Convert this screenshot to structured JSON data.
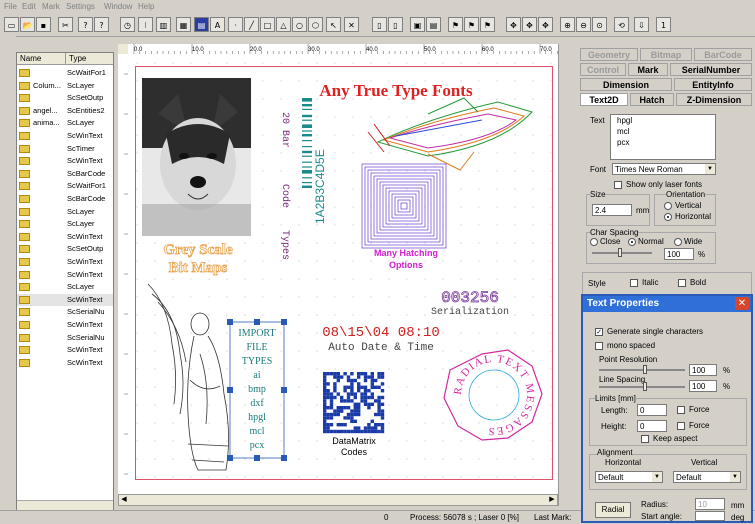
{
  "menu": [
    "File",
    "Edit",
    "Mark",
    "Settings",
    "Window",
    "Help"
  ],
  "toolbar": {
    "groups": [
      "new",
      "open",
      "save",
      "cut",
      "help",
      "whats-this",
      "clock",
      "marker",
      "barcode",
      "hatch",
      "text",
      "point",
      "line",
      "rect",
      "triangle",
      "circle",
      "polygon",
      "pointer",
      "cross",
      "doc-a",
      "doc-b",
      "doc-c",
      "doc-d",
      "doc-e",
      "doc-f",
      "doc-g",
      "move-a",
      "move-b",
      "move-c",
      "zoom-in",
      "zoom-out",
      "zoom-fit",
      "rotate-a",
      "rotate-b"
    ],
    "digit": "1"
  },
  "ruler_h": [
    "0.0",
    "10.0",
    "20.0",
    "30.0",
    "40.0",
    "50.0",
    "60.0",
    "70.0"
  ],
  "object_list": {
    "headers": {
      "name": "Name",
      "type": "Type"
    },
    "rows": [
      {
        "name": "",
        "type": "ScWaitFor1"
      },
      {
        "name": "Colum...",
        "type": "ScLayer"
      },
      {
        "name": "",
        "type": "ScSetOutp"
      },
      {
        "name": "angel...",
        "type": "ScEntities2"
      },
      {
        "name": "anima...",
        "type": "ScLayer"
      },
      {
        "name": "",
        "type": "ScWinText"
      },
      {
        "name": "",
        "type": "ScTimer"
      },
      {
        "name": "",
        "type": "ScWinText"
      },
      {
        "name": "",
        "type": "ScBarCode"
      },
      {
        "name": "",
        "type": "ScWaitFor1"
      },
      {
        "name": "",
        "type": "ScBarCode"
      },
      {
        "name": "",
        "type": "ScLayer"
      },
      {
        "name": "",
        "type": "ScLayer"
      },
      {
        "name": "",
        "type": "ScWinText"
      },
      {
        "name": "",
        "type": "ScSetOutp"
      },
      {
        "name": "",
        "type": "ScWinText"
      },
      {
        "name": "",
        "type": "ScWinText"
      },
      {
        "name": "",
        "type": "ScLayer"
      },
      {
        "name": "",
        "type": "ScWinText"
      },
      {
        "name": "",
        "type": "ScSerialNu"
      },
      {
        "name": "",
        "type": "ScWinText"
      },
      {
        "name": "",
        "type": "ScSerialNu"
      },
      {
        "name": "",
        "type": "ScWinText"
      },
      {
        "name": "",
        "type": "ScWinText"
      }
    ]
  },
  "canvas": {
    "title_text": "Any True Type Fonts",
    "grey_scale": [
      "Grey Scale",
      "Bit Maps"
    ],
    "barcode_label": [
      "20 Bar",
      "Code",
      "Types"
    ],
    "barcode_value": "1A2B3C4D5E",
    "hatching": [
      "Many Hatching",
      "Options"
    ],
    "serial_number": "003256",
    "serial_label": "Serialization",
    "date_time": "08\\15\\04 08:10",
    "date_label": "Auto Date & Time",
    "import_lines": [
      "IMPORT",
      "FILE",
      "TYPES",
      "ai",
      "bmp",
      "dxf",
      "hpgl",
      "mcl",
      "pcx"
    ],
    "datamatrix_label": [
      "DataMatrix",
      "Codes"
    ],
    "radial_text": "RADIAL TEXT MESSAGES"
  },
  "status": {
    "count": "0",
    "process": "Process:  56078 s ; Laser  0 [%]",
    "last_mark": "Last Mark:"
  },
  "right_panel": {
    "tabs_row1": [
      "Geometry",
      "Bitmap",
      "BarCode"
    ],
    "tabs_row2": [
      "Control",
      "Mark",
      "SerialNumber"
    ],
    "tabs_row3": [
      "Dimension",
      "EntityInfo"
    ],
    "tabs_row4": [
      "Text2D",
      "Hatch",
      "Z-Dimension"
    ],
    "text_label": "Text",
    "text_lines": [
      "hpgl",
      "mcl",
      "pcx"
    ],
    "font_label": "Font",
    "font_value": "Times New Roman",
    "only_laser_fonts": "Show only laser fonts",
    "size_label": "Size",
    "size_value": "2.4",
    "size_unit": "mm",
    "orientation_label": "Orientation",
    "orient_vertical": "Vertical",
    "orient_horizontal": "Horizontal",
    "char_spacing_label": "Char Spacing",
    "spacing_close": "Close",
    "spacing_normal": "Normal",
    "spacing_wide": "Wide",
    "spacing_value": "100",
    "percent": "%",
    "style_label": "Style",
    "italic": "Italic",
    "bold": "Bold"
  },
  "dialog": {
    "title": "Text Properties",
    "generate_single": "Generate single characters",
    "mono_spaced": "mono spaced",
    "point_resolution": "Point Resolution",
    "point_resolution_value": "100",
    "line_spacing": "Line Spacing",
    "line_spacing_value": "100",
    "percent": "%",
    "limits_label": "Limits [mm]",
    "length_label": "Length:",
    "length_value": "0",
    "height_label": "Height:",
    "height_value": "0",
    "force": "Force",
    "keep_aspect": "Keep aspect",
    "alignment_label": "Alignment",
    "horizontal_label": "Horizontal",
    "vertical_label": "Vertical",
    "h_align_value": "Default",
    "v_align_value": "Default",
    "radial_button": "Radial",
    "radius_label": "Radius:",
    "radius_value": "10",
    "radius_unit": "mm",
    "start_angle_label": "Start angle:",
    "start_angle_unit": "deg"
  }
}
